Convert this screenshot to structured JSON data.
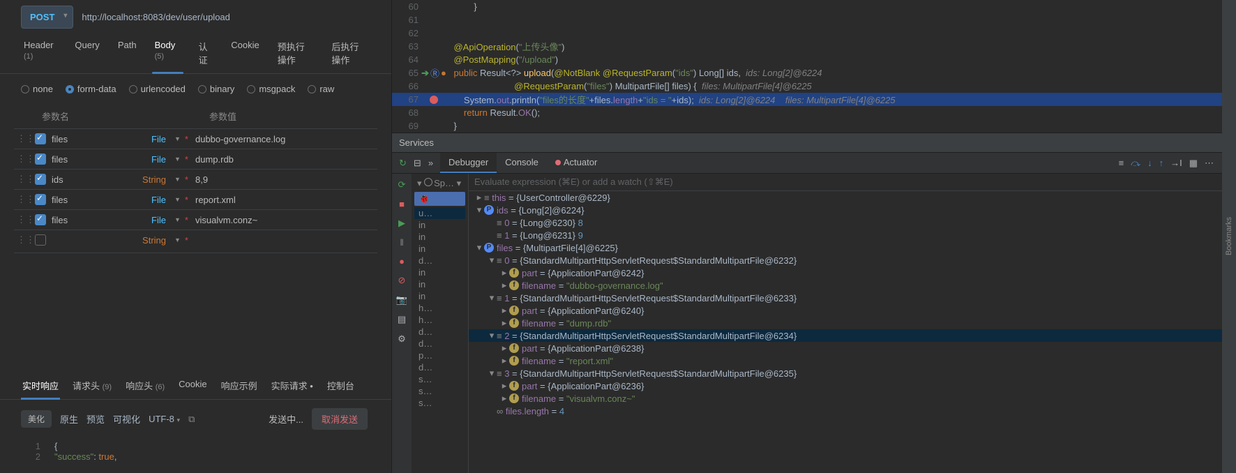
{
  "request": {
    "method": "POST",
    "url": "http://localhost:8083/dev/user/upload"
  },
  "req_tabs": [
    {
      "label": "Header",
      "count": "(1)"
    },
    {
      "label": "Query"
    },
    {
      "label": "Path"
    },
    {
      "label": "Body",
      "count": "(5)",
      "active": true
    },
    {
      "label": "认证"
    },
    {
      "label": "Cookie"
    },
    {
      "label": "预执行操作"
    },
    {
      "label": "后执行操作"
    }
  ],
  "body_types": [
    "none",
    "form-data",
    "urlencoded",
    "binary",
    "msgpack",
    "raw"
  ],
  "body_selected": "form-data",
  "param_headers": {
    "name": "参数名",
    "value": "参数值"
  },
  "params": [
    {
      "checked": true,
      "name": "files",
      "type": "File",
      "value": "dubbo-governance.log"
    },
    {
      "checked": true,
      "name": "files",
      "type": "File",
      "value": "dump.rdb"
    },
    {
      "checked": true,
      "name": "ids",
      "type": "String",
      "value": "8,9"
    },
    {
      "checked": true,
      "name": "files",
      "type": "File",
      "value": "report.xml"
    },
    {
      "checked": true,
      "name": "files",
      "type": "File",
      "value": "visualvm.conz~"
    },
    {
      "checked": false,
      "name": "",
      "type": "String",
      "value": ""
    }
  ],
  "resp_tabs": [
    {
      "label": "实时响应",
      "active": true
    },
    {
      "label": "请求头",
      "count": "(9)"
    },
    {
      "label": "响应头",
      "count": "(6)"
    },
    {
      "label": "Cookie"
    },
    {
      "label": "响应示例"
    },
    {
      "label": "实际请求 •"
    },
    {
      "label": "控制台"
    }
  ],
  "toolbar": {
    "b1": "美化",
    "b2": "原生",
    "b3": "预览",
    "b4": "可视化",
    "enc": "UTF-8",
    "sending": "发送中...",
    "cancel": "取消发送"
  },
  "response_code": {
    "l1": "{",
    "l2": "\"success\": true,"
  },
  "editor_lines": [
    {
      "n": 60,
      "html": "            }"
    },
    {
      "n": 61,
      "html": ""
    },
    {
      "n": 62,
      "html": ""
    },
    {
      "n": 63,
      "html": "    <span class='ann'>@ApiOperation</span>(<span class='str'>\"上传头像\"</span>)"
    },
    {
      "n": 64,
      "html": "    <span class='ann'>@PostMapping</span>(<span class='str'>\"/upload\"</span>)"
    },
    {
      "n": 65,
      "arrow": true,
      "rec": true,
      "html": "    <span class='kw'>public</span> Result&lt;?&gt; <span class='id'>upload</span>(<span class='ann'>@NotBlank</span> <span class='ann'>@RequestParam</span>(<span class='str'>\"ids\"</span>) Long[] ids,  <span class='cmnt'>ids: Long[2]@6224</span>"
    },
    {
      "n": 66,
      "html": "                            <span class='ann'>@RequestParam</span>(<span class='str'>\"files\"</span>) MultipartFile[] files) {  <span class='cmnt'>files: MultipartFile[4]@6225</span>"
    },
    {
      "n": 67,
      "bp": true,
      "hl": true,
      "html": "        System.<span class='fld'>out</span>.println(<span class='str'>\"files的长度\"</span>+files.<span class='fld'>length</span>+<span class='str'>\"ids = \"</span>+ids);  <span class='cmnt'>ids: Long[2]@6224    files: MultipartFile[4]@6225</span>"
    },
    {
      "n": 68,
      "html": "        <span class='kw'>return</span> Result.<span class='fld'>OK</span>();"
    },
    {
      "n": 69,
      "html": "    }"
    }
  ],
  "services_label": "Services",
  "dbg_tabs": [
    {
      "label": "Debugger",
      "active": true
    },
    {
      "label": "Console"
    },
    {
      "label": "Actuator"
    }
  ],
  "eval_placeholder": "Evaluate expression (⌘E) or add a watch (⇧⌘E)",
  "thread": {
    "spring": "Sp…",
    "frame_sel": "u…",
    "frames": [
      "in",
      "in",
      "in",
      "d…",
      "in",
      "in",
      "in",
      "h…",
      "h…",
      "d…",
      "d…",
      "p…",
      "d…",
      "s…",
      "s…",
      "s…"
    ]
  },
  "vars": [
    {
      "d": 0,
      "tw": "▸",
      "icon": "",
      "text": "<span class='vname'>this</span> = {UserController@6229}"
    },
    {
      "d": 0,
      "tw": "▾",
      "icon": "p",
      "text": "<span class='vname'>ids</span> = {Long[2]@6224}"
    },
    {
      "d": 1,
      "tw": "",
      "icon": "",
      "text": "<span class='vname'>0</span> = {Long@6230} <span class='vnum'>8</span>"
    },
    {
      "d": 1,
      "tw": "",
      "icon": "",
      "text": "<span class='vname'>1</span> = {Long@6231} <span class='vnum'>9</span>"
    },
    {
      "d": 0,
      "tw": "▾",
      "icon": "p",
      "text": "<span class='vname'>files</span> = {MultipartFile[4]@6225}"
    },
    {
      "d": 1,
      "tw": "▾",
      "icon": "",
      "text": "<span class='vname'>0</span> = {StandardMultipartHttpServletRequest$StandardMultipartFile@6232}"
    },
    {
      "d": 2,
      "tw": "▸",
      "icon": "f",
      "text": "<span class='vname'>part</span> = {ApplicationPart@6242}"
    },
    {
      "d": 2,
      "tw": "▸",
      "icon": "f",
      "text": "<span class='vname'>filename</span> = <span class='vstr'>\"dubbo-governance.log\"</span>"
    },
    {
      "d": 1,
      "tw": "▾",
      "icon": "",
      "text": "<span class='vname'>1</span> = {StandardMultipartHttpServletRequest$StandardMultipartFile@6233}"
    },
    {
      "d": 2,
      "tw": "▸",
      "icon": "f",
      "text": "<span class='vname'>part</span> = {ApplicationPart@6240}"
    },
    {
      "d": 2,
      "tw": "▸",
      "icon": "f",
      "text": "<span class='vname'>filename</span> = <span class='vstr'>\"dump.rdb\"</span>"
    },
    {
      "d": 1,
      "tw": "▾",
      "icon": "",
      "sel": true,
      "text": "<span class='vname'>2</span> = {StandardMultipartHttpServletRequest$StandardMultipartFile@6234}"
    },
    {
      "d": 2,
      "tw": "▸",
      "icon": "f",
      "text": "<span class='vname'>part</span> = {ApplicationPart@6238}"
    },
    {
      "d": 2,
      "tw": "▸",
      "icon": "f",
      "text": "<span class='vname'>filename</span> = <span class='vstr'>\"report.xml\"</span>"
    },
    {
      "d": 1,
      "tw": "▾",
      "icon": "",
      "text": "<span class='vname'>3</span> = {StandardMultipartHttpServletRequest$StandardMultipartFile@6235}"
    },
    {
      "d": 2,
      "tw": "▸",
      "icon": "f",
      "text": "<span class='vname'>part</span> = {ApplicationPart@6236}"
    },
    {
      "d": 2,
      "tw": "▸",
      "icon": "f",
      "text": "<span class='vname'>filename</span> = <span class='vstr'>\"visualvm.conz~\"</span>"
    },
    {
      "d": 1,
      "tw": "",
      "icon": "",
      "link": true,
      "text": "<span class='vname'>files.length</span> = <span class='vnum'>4</span>"
    }
  ],
  "bookmark": "Bookmarks"
}
